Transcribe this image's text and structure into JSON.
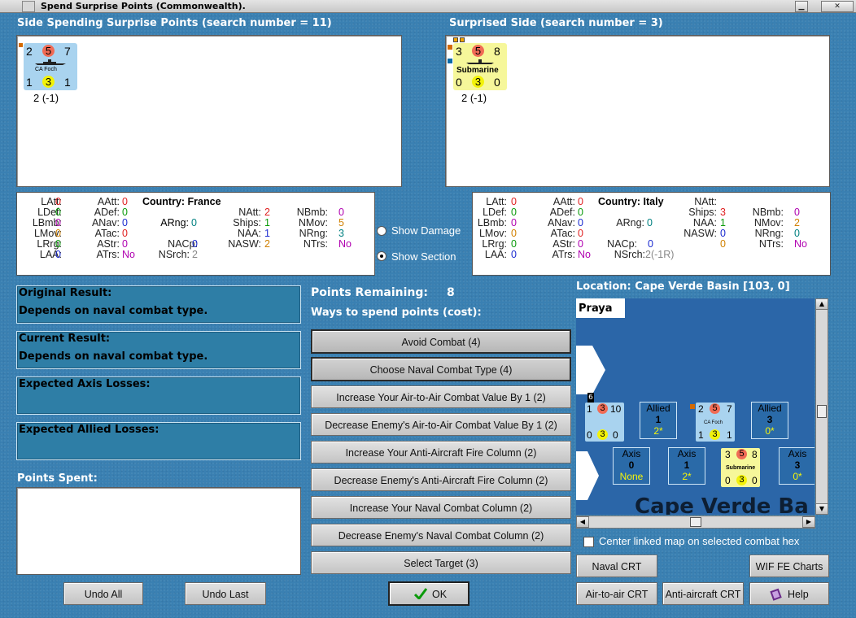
{
  "window": {
    "title": "Spend Surprise Points (Commonwealth)."
  },
  "left": {
    "header": "Side Spending Surprise Points (search number = 11)",
    "counter": {
      "att": "2",
      "mid": "5",
      "def": "7",
      "name": "CA Foch",
      "b1": "1",
      "b2": "3",
      "b3": "1",
      "note": "2 (-1)"
    },
    "stats": {
      "latt": "LAtt:",
      "latt_v": "0",
      "ldef": "LDef:",
      "ldef_v": "0",
      "lbmb": "LBmb:",
      "lbmb_v": "0",
      "lmov": "LMov:",
      "lmov_v": "0",
      "lrrg": "LRrg:",
      "lrrg_v": "0",
      "laa": "LAA:",
      "laa_v": "0",
      "aatt": "AAtt:",
      "aatt_v": "0",
      "adef": "ADef:",
      "adef_v": "0",
      "anav": "ANav:",
      "anav_v": "0",
      "atac": "ATac:",
      "atac_v": "0",
      "astr": "AStr:",
      "astr_v": "0",
      "atrs": "ATrs:",
      "atrs_v": "No",
      "country": "Country: France",
      "arng": "ARng:",
      "arng_v": "0",
      "nacp": "NACp:",
      "nacp_v": "0",
      "nsrch": "NSrch:",
      "nsrch_v": "2",
      "natt": "NAtt:",
      "natt_v": "2",
      "ships": "Ships:",
      "ships_v": "1",
      "naa": "NAA:",
      "naa_v": "1",
      "nasw": "NASW:",
      "nasw_v": "2",
      "nbmb": "NBmb:",
      "nbmb_v": "0",
      "nmov": "NMov:",
      "nmov_v": "5",
      "nrng": "NRng:",
      "nrng_v": "3",
      "ntrs": "NTrs:",
      "ntrs_v": "No"
    }
  },
  "right": {
    "header": "Surprised Side (search number = 3)",
    "counter": {
      "att": "3",
      "mid": "5",
      "def": "8",
      "name": "Submarine",
      "b1": "0",
      "b2": "3",
      "b3": "0",
      "note": "2 (-1)"
    },
    "stats": {
      "latt": "LAtt:",
      "latt_v": "0",
      "ldef": "LDef:",
      "ldef_v": "0",
      "lbmb": "LBmb:",
      "lbmb_v": "0",
      "lmov": "LMov:",
      "lmov_v": "0",
      "lrrg": "LRrg:",
      "lrrg_v": "0",
      "laa": "LAA:",
      "laa_v": "0",
      "aatt": "AAtt:",
      "aatt_v": "0",
      "adef": "ADef:",
      "adef_v": "0",
      "anav": "ANav:",
      "anav_v": "0",
      "atac": "ATac:",
      "atac_v": "0",
      "astr": "AStr:",
      "astr_v": "0",
      "atrs": "ATrs:",
      "atrs_v": "No",
      "country": "Country: Italy",
      "arng": "ARng:",
      "arng_v": "0",
      "nacp": "NACp:",
      "nacp_v": "0",
      "nsrch": "NSrch:",
      "nsrch_v": "2(-1R)",
      "natt": "NAtt:",
      "natt_v": "3",
      "ships": "Ships:",
      "ships_v": "1",
      "naa": "NAA:",
      "naa_v": "0",
      "nasw": "NASW:",
      "nasw_v": "0",
      "nbmb": "NBmb:",
      "nbmb_v": "0",
      "nmov": "NMov:",
      "nmov_v": "2",
      "nrng": "NRng:",
      "nrng_v": "0",
      "ntrs": "NTrs:",
      "ntrs_v": "No"
    }
  },
  "options": {
    "show_damage": "Show Damage",
    "show_section": "Show Section"
  },
  "results": {
    "original_label": "Original Result:",
    "original_value": "Depends on naval combat type.",
    "current_label": "Current Result:",
    "current_value": "Depends on naval combat type.",
    "axis_losses": "Expected Axis Losses:",
    "allied_losses": "Expected Allied Losses:",
    "points_spent": "Points Spent:"
  },
  "spend": {
    "points_remaining_label": "Points Remaining:",
    "points_remaining": "8",
    "ways_label": "Ways to spend points (cost):",
    "buttons": [
      "Avoid Combat (4)",
      "Choose Naval Combat Type (4)",
      "Increase Your Air-to-Air Combat Value By 1 (2)",
      "Decrease Enemy's Air-to-Air Combat Value By 1 (2)",
      "Increase Your Anti-Aircraft Fire Column (2)",
      "Decrease Enemy's Anti-Aircraft Fire Column (2)",
      "Increase Your Naval Combat Column (2)",
      "Decrease Enemy's Naval Combat Column (2)",
      "Select Target (3)"
    ]
  },
  "bottom": {
    "undo_all": "Undo All",
    "undo_last": "Undo Last",
    "ok": "OK"
  },
  "map": {
    "location": "Location: Cape Verde Basin [103, 0]",
    "place": "Praya",
    "sea_name": "Cape Verde Ba",
    "stack_count": "6",
    "unit1": {
      "t1": "1",
      "t2": "3",
      "t3": "10",
      "b1": "0",
      "b2": "3",
      "b3": "0"
    },
    "unit2": {
      "t1": "2",
      "t2": "5",
      "t3": "7",
      "name": "CA Foch",
      "b1": "1",
      "b2": "3",
      "b3": "1"
    },
    "unit3": {
      "t1": "3",
      "t2": "5",
      "t3": "8",
      "name": "Submarine",
      "b1": "0",
      "b2": "3",
      "b3": "0"
    },
    "allied1": {
      "label": "Allied",
      "n": "1",
      "s": "2*"
    },
    "allied2": {
      "label": "Allied",
      "n": "3",
      "s": "0*"
    },
    "axis1": {
      "label": "Axis",
      "n": "0",
      "s": "None"
    },
    "axis2": {
      "label": "Axis",
      "n": "1",
      "s": "2*"
    },
    "axis3": {
      "label": "Axis",
      "n": "3",
      "s": "0*"
    },
    "center_linked": "Center linked map on selected combat hex",
    "naval_crt": "Naval CRT",
    "wif_charts": "WIF FE Charts",
    "air_crt": "Air-to-air CRT",
    "aa_crt": "Anti-aircraft CRT",
    "help": "Help"
  },
  "colors": {
    "background": "#3a80b2",
    "panel": "#2e7ea6",
    "counter_blue": "#a9d3ef",
    "counter_yellow": "#f6f79a",
    "sea": "#2b66a8"
  }
}
